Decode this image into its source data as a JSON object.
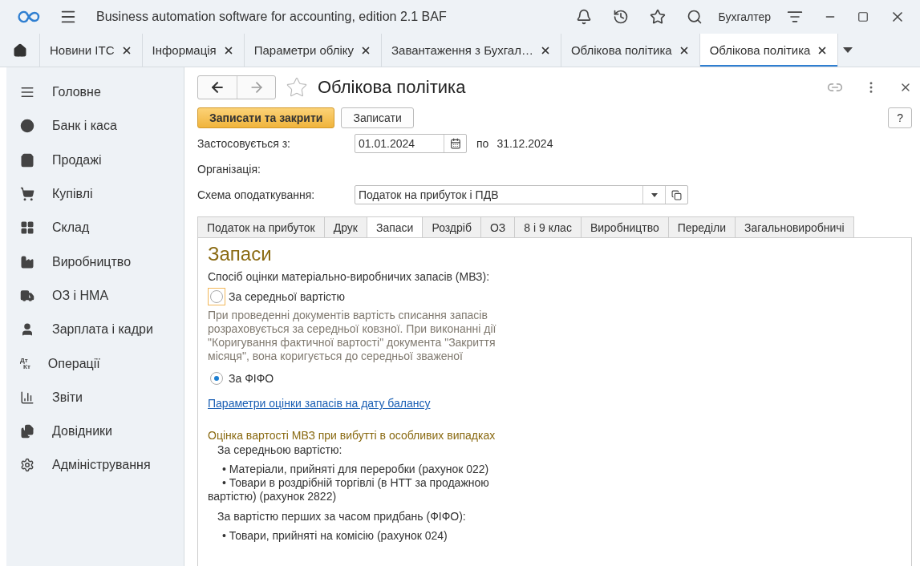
{
  "app": {
    "title": "Business automation software for accounting, edition 2.1 BAF",
    "user": "Бухгалтер"
  },
  "open_tabs": [
    {
      "label": "Новини ІТС",
      "selected": false
    },
    {
      "label": "Інформація",
      "selected": false
    },
    {
      "label": "Параметри обліку",
      "selected": false
    },
    {
      "label": "Завантаження з Бухгал…",
      "selected": false
    },
    {
      "label": "Облікова політика",
      "selected": false
    },
    {
      "label": "Облікова політика",
      "selected": true
    }
  ],
  "sidebar": {
    "items": [
      {
        "label": "Головне"
      },
      {
        "label": "Банк і каса"
      },
      {
        "label": "Продажі"
      },
      {
        "label": "Купівлі"
      },
      {
        "label": "Склад"
      },
      {
        "label": "Виробництво"
      },
      {
        "label": "ОЗ і НМА"
      },
      {
        "label": "Зарплата і кадри"
      },
      {
        "label": "Операції",
        "icon_text": [
          "Дт",
          "Кт"
        ]
      },
      {
        "label": "Звіти"
      },
      {
        "label": "Довідники"
      },
      {
        "label": "Адміністрування"
      }
    ]
  },
  "form": {
    "title": "Облікова політика",
    "favorite": false,
    "buttons": [
      {
        "label": "Записати та закрити",
        "kind": "primary"
      },
      {
        "label": "Записати",
        "kind": "default"
      }
    ],
    "help": "?",
    "period": {
      "label": "Застосовується з:",
      "from": "01.01.2024",
      "to_label": "по",
      "to": "31.12.2024"
    },
    "organization": {
      "label": "Організація:"
    },
    "tax_scheme": {
      "label": "Схема оподаткування:",
      "value": "Податок на прибуток і ПДВ"
    },
    "sections": [
      {
        "label": "Податок на прибуток",
        "selected": false
      },
      {
        "label": "Друк",
        "selected": false
      },
      {
        "label": "Запаси",
        "selected": true
      },
      {
        "label": "Роздріб",
        "selected": false
      },
      {
        "label": "ОЗ",
        "selected": false
      },
      {
        "label": "8 і 9 клас",
        "selected": false
      },
      {
        "label": "Виробництво",
        "selected": false
      },
      {
        "label": "Переділи",
        "selected": false
      },
      {
        "label": "Загальновиробничі",
        "selected": false
      }
    ],
    "panel": {
      "heading": "Запаси",
      "method_label": "Спосіб оцінки матеріально-виробничих запасів (МВЗ):",
      "options": [
        {
          "label": "За середньої вартістю",
          "selected": false,
          "focused": true,
          "description": "При проведенні документів вартість списання запасів розраховується за середньої ковзної. При виконанні дії \"Коригування фактичної вартості\" документа \"Закриття місяця\", вона коригується до середньої зваженої"
        },
        {
          "label": "За ФІФО",
          "selected": true,
          "focused": false
        }
      ],
      "link": "Параметри оцінки запасів на дату балансу",
      "special": {
        "heading": "Оцінка вартості МВЗ при вибутті в особливих випадках",
        "groups": [
          {
            "title": "За середньою вартістю:",
            "items": [
              "• Матеріали, прийняті для переробки (рахунок 022)",
              "• Товари в роздрібній торгівлі (в НТТ за продажною вартістю) (рахунок 2822)"
            ]
          },
          {
            "title": "За вартістю перших за часом придбань (ФІФО):",
            "items": [
              "• Товари, прийняті на комісію (рахунок 024)"
            ]
          }
        ]
      }
    }
  }
}
